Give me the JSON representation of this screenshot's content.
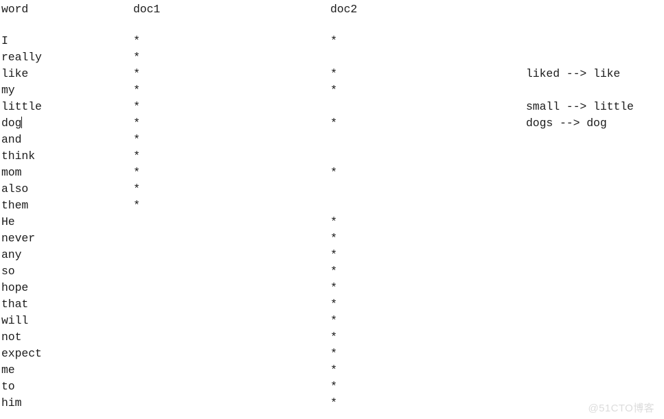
{
  "document": {
    "background_color": "#ffffff",
    "text_color": "#1b1b1b",
    "headers": {
      "word": "word",
      "doc1": "doc1",
      "doc2": "doc2"
    },
    "star_glyph": "*",
    "rows": [
      {
        "word": "I",
        "doc1": true,
        "doc2": true,
        "caret": false
      },
      {
        "word": "really",
        "doc1": true,
        "doc2": false,
        "caret": false
      },
      {
        "word": "like",
        "doc1": true,
        "doc2": true,
        "caret": false
      },
      {
        "word": "my",
        "doc1": true,
        "doc2": true,
        "caret": false
      },
      {
        "word": "little",
        "doc1": true,
        "doc2": false,
        "caret": false
      },
      {
        "word": "dog",
        "doc1": true,
        "doc2": true,
        "caret": true
      },
      {
        "word": "and",
        "doc1": true,
        "doc2": false,
        "caret": false
      },
      {
        "word": "think",
        "doc1": true,
        "doc2": false,
        "caret": false
      },
      {
        "word": "mom",
        "doc1": true,
        "doc2": true,
        "caret": false
      },
      {
        "word": "also",
        "doc1": true,
        "doc2": false,
        "caret": false
      },
      {
        "word": "them",
        "doc1": true,
        "doc2": false,
        "caret": false
      },
      {
        "word": "He",
        "doc1": false,
        "doc2": true,
        "caret": false
      },
      {
        "word": "never",
        "doc1": false,
        "doc2": true,
        "caret": false
      },
      {
        "word": "any",
        "doc1": false,
        "doc2": true,
        "caret": false
      },
      {
        "word": "so",
        "doc1": false,
        "doc2": true,
        "caret": false
      },
      {
        "word": "hope",
        "doc1": false,
        "doc2": true,
        "caret": false
      },
      {
        "word": "that",
        "doc1": false,
        "doc2": true,
        "caret": false
      },
      {
        "word": "will",
        "doc1": false,
        "doc2": true,
        "caret": false
      },
      {
        "word": "not",
        "doc1": false,
        "doc2": true,
        "caret": false
      },
      {
        "word": "expect",
        "doc1": false,
        "doc2": true,
        "caret": false
      },
      {
        "word": "me",
        "doc1": false,
        "doc2": true,
        "caret": false
      },
      {
        "word": "to",
        "doc1": false,
        "doc2": true,
        "caret": false
      },
      {
        "word": "him",
        "doc1": false,
        "doc2": true,
        "caret": false
      }
    ],
    "annotations": [
      {
        "text": "liked --> like",
        "row_word": "like"
      },
      {
        "text": "small --> little",
        "row_word": "little"
      },
      {
        "text": "dogs --> dog",
        "row_word": "dog"
      }
    ]
  },
  "watermark": {
    "text": "@51CTO博客",
    "color": "#dcdcdc"
  }
}
